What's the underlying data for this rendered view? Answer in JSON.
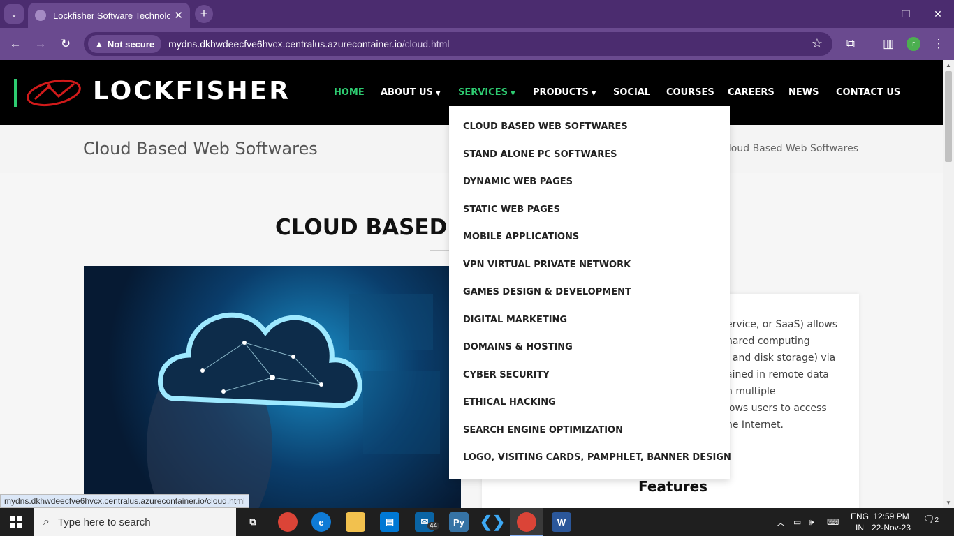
{
  "browser": {
    "tab_title": "Lockfisher Software Technolog",
    "security_label": "Not secure",
    "url_host": "mydns.dkhwdeecfve6hvcx.centralus.azurecontainer.io",
    "url_path": "/cloud.html",
    "profile_initial": "r",
    "status_url": "mydns.dkhwdeecfve6hvcx.centralus.azurecontainer.io/cloud.html"
  },
  "site": {
    "logo_text": "LOCKFISHER",
    "nav": [
      {
        "label": "HOME",
        "active": true
      },
      {
        "label": "ABOUT US"
      },
      {
        "label": "SERVICES",
        "active": true
      },
      {
        "label": "PRODUCTS"
      },
      {
        "label": "SOCIAL"
      },
      {
        "label": "COURSES"
      },
      {
        "label": "CAREERS"
      },
      {
        "label": "NEWS"
      },
      {
        "label": "CONTACT US"
      }
    ],
    "page_title": "Cloud Based Web Softwares",
    "breadcrumb_current": "Cloud Based Web Softwares",
    "heading": "CLOUD BASED",
    "services_menu": [
      "CLOUD BASED WEB SOFTWARES",
      "STAND ALONE PC SOFTWARES",
      "DYNAMIC WEB PAGES",
      "STATIC WEB PAGES",
      "MOBILE APPLICATIONS",
      "VPN VIRTUAL PRIVATE NETWORK",
      "GAMES DESIGN & DEVELOPMENT",
      "DIGITAL MARKETING",
      "DOMAINS & HOSTING",
      "CYBER SECURITY",
      "ETHICAL HACKING",
      "SEARCH ENGINE OPTIMIZATION",
      "LOGO, VISITING CARDS, PAMPHLET, BANNER DESIGN"
    ],
    "body_lines": [
      "ervice, or SaaS) allows",
      "hared computing",
      ", and disk storage) via",
      "ained in remote data",
      "n multiple",
      "lows users to access",
      "he Internet."
    ],
    "features_heading": "Features"
  },
  "taskbar": {
    "search_placeholder": "Type here to search",
    "mail_badge": "44",
    "lang_line1": "ENG",
    "lang_line2": "IN",
    "time": "12:59 PM",
    "date": "22-Nov-23",
    "notification_count": "2"
  },
  "colors": {
    "accent_green": "#2ecc71",
    "chrome_purple": "#6a4a8f",
    "logo_red": "#d11a1a"
  }
}
